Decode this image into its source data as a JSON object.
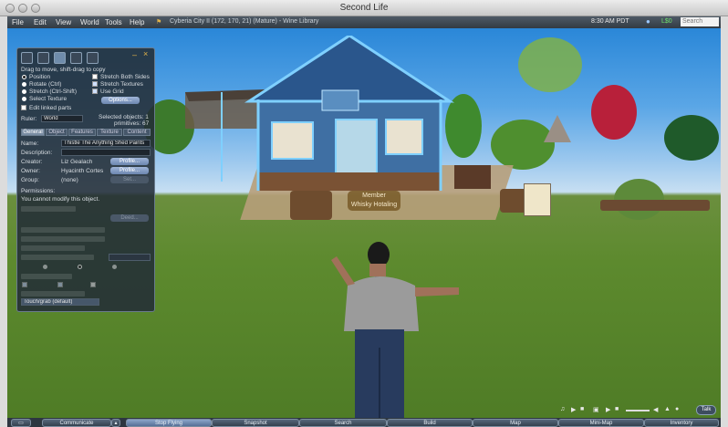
{
  "window": {
    "title": "Second Life"
  },
  "menubar": {
    "items": [
      "File",
      "Edit",
      "View",
      "World",
      "Tools",
      "Help"
    ],
    "location": "Cyberia City II (172, 170, 21) (Mature) - Wine Library",
    "clock": "8:30 AM PDT",
    "balance": "L$0",
    "search_placeholder": "Search"
  },
  "build_floater": {
    "hint": "Drag to move, shift-drag to copy",
    "modes": [
      "Position",
      "Rotate (Ctrl)",
      "Stretch (Ctrl-Shift)",
      "Select Texture"
    ],
    "selected_mode": "Position",
    "checks": [
      "Stretch Both Sides",
      "Stretch Textures",
      "Use Grid"
    ],
    "options_label": "Options...",
    "edit_linked": "Edit linked parts",
    "ruler_label": "Ruler:",
    "ruler_value": "World",
    "selected_objects": "Selected objects: 1",
    "primitives": "primitives: 67",
    "tabs": [
      "General",
      "Object",
      "Features",
      "Texture",
      "Content"
    ],
    "active_tab": "General",
    "name_label": "Name:",
    "name_value": "Thistle The Anything Shed Paints",
    "description_label": "Description:",
    "description_value": "",
    "creator_label": "Creator:",
    "creator_value": "Liz Gealach",
    "owner_label": "Owner:",
    "owner_value": "Hyacinth Cortes",
    "group_label": "Group:",
    "group_value": "(none)",
    "profile_label": "Profile...",
    "set_label": "Set...",
    "deed_label": "Deed...",
    "permissions_label": "Permissions:",
    "permissions_note": "You cannot modify this object.",
    "click_action": "Touch/grab (default)"
  },
  "scene": {
    "tag_line1": "Member",
    "tag_line2": "Whisky Hotaling"
  },
  "bottombar": {
    "buttons": [
      "Communicate",
      "Stop Flying",
      "Snapshot",
      "Search",
      "Build",
      "Map",
      "Mini-Map",
      "Inventory"
    ],
    "talk_label": "Talk"
  }
}
